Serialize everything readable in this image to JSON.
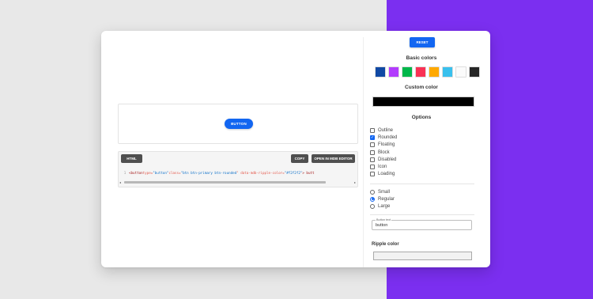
{
  "preview": {
    "button_label": "button"
  },
  "code": {
    "tab_label": "HTML",
    "copy_label": "COPY",
    "open_label": "OPEN IN MDB EDITOR",
    "line_number": "1",
    "segments": {
      "open": "<button ",
      "type_attr": "type=",
      "type_val": "\"button\"",
      "class_attr": " class=",
      "class_val": "\"btn btn-primary btn-rounded",
      "ripple_attr": "\" data-mdb-ripple-color=",
      "ripple_val": "\"#f2f2f2\"",
      "rest": "> butt"
    }
  },
  "panel": {
    "reset_label": "RESET",
    "basic_colors_title": "Basic colors",
    "basic_colors": [
      "#1049a4",
      "#b23cfd",
      "#00b74a",
      "#f93154",
      "#ffa900",
      "#39c0ed",
      "#fbfbfb",
      "#262626"
    ],
    "custom_color_title": "Custom color",
    "custom_color": "#000000",
    "options_title": "Options",
    "options": [
      {
        "label": "Outline",
        "checked": false
      },
      {
        "label": "Rounded",
        "checked": true
      },
      {
        "label": "Floating",
        "checked": false
      },
      {
        "label": "Block",
        "checked": false
      },
      {
        "label": "Disabled",
        "checked": false
      },
      {
        "label": "Icon",
        "checked": false
      },
      {
        "label": "Loading",
        "checked": false
      }
    ],
    "sizes": [
      {
        "label": "Small",
        "checked": false
      },
      {
        "label": "Regular",
        "checked": true
      },
      {
        "label": "Large",
        "checked": false
      }
    ],
    "button_text_label": "Button text",
    "button_text_value": "button",
    "ripple_color_title": "Ripple color",
    "ripple_color": "#f2f2f2"
  },
  "colors": {
    "accent": "#1266f1",
    "background_right": "#7b2ff0"
  }
}
